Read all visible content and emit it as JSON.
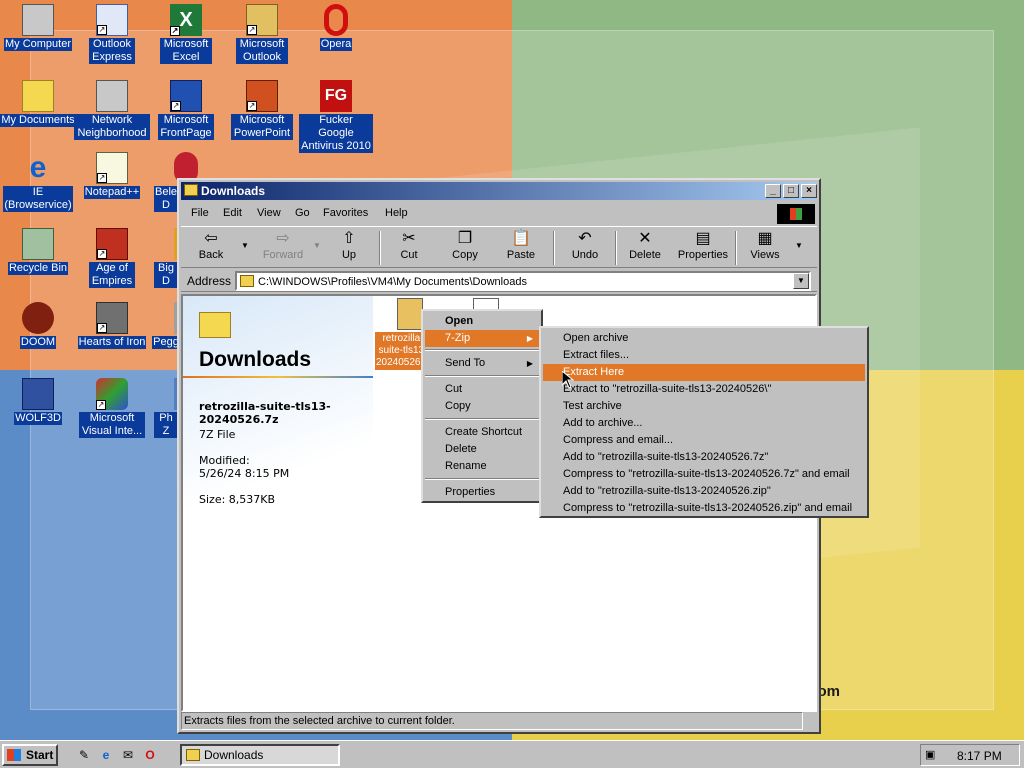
{
  "desktop": {
    "brand_fragment": "t.com",
    "icons": [
      {
        "label": "My Computer"
      },
      {
        "label": "Outlook Express"
      },
      {
        "label": "Microsoft Excel"
      },
      {
        "label": "Microsoft Outlook"
      },
      {
        "label": "Opera"
      },
      {
        "label": "My Documents"
      },
      {
        "label": "Network Neighborhood"
      },
      {
        "label": "Microsoft FrontPage"
      },
      {
        "label": "Microsoft PowerPoint"
      },
      {
        "label": "Fucker Google Antivirus 2010"
      },
      {
        "label": "IE (Browservice)"
      },
      {
        "label": "Notepad++"
      },
      {
        "label": "Bele D"
      },
      {
        "label": "Recycle Bin"
      },
      {
        "label": "Age of Empires"
      },
      {
        "label": "Big D"
      },
      {
        "label": "DOOM"
      },
      {
        "label": "Hearts of Iron"
      },
      {
        "label": "Pegg"
      },
      {
        "label": "WOLF3D"
      },
      {
        "label": "Microsoft Visual Inte..."
      },
      {
        "label": "Ph Z"
      }
    ]
  },
  "window": {
    "title": "Downloads",
    "menu": {
      "file": "File",
      "edit": "Edit",
      "view": "View",
      "go": "Go",
      "favorites": "Favorites",
      "help": "Help"
    },
    "toolbar": {
      "back": "Back",
      "forward": "Forward",
      "up": "Up",
      "cut": "Cut",
      "copy": "Copy",
      "paste": "Paste",
      "undo": "Undo",
      "delete": "Delete",
      "properties": "Properties",
      "views": "Views"
    },
    "address": {
      "label": "Address",
      "path": "C:\\WINDOWS\\Profiles\\VM4\\My Documents\\Downloads"
    },
    "panel": {
      "title": "Downloads",
      "file_name": "retrozilla-suite-tls13-20240526.7z",
      "file_type": "7Z File",
      "modified_label": "Modified:",
      "modified_value": "5/26/24 8:15 PM",
      "size": "Size: 8,537KB"
    },
    "selected_file_label": "retrozilla-suite-tls13-20240526.7z",
    "status": "Extracts files from the selected archive to current folder."
  },
  "context_menu": {
    "open": "Open",
    "seven_zip": "7-Zip",
    "send_to": "Send To",
    "cut": "Cut",
    "copy": "Copy",
    "create_shortcut": "Create Shortcut",
    "delete": "Delete",
    "rename": "Rename",
    "properties": "Properties"
  },
  "submenu": {
    "items": [
      "Open archive",
      "Extract files...",
      "Extract Here",
      "Extract to \"retrozilla-suite-tls13-20240526\\\"",
      "Test archive",
      "Add to archive...",
      "Compress and email...",
      "Add to \"retrozilla-suite-tls13-20240526.7z\"",
      "Compress to \"retrozilla-suite-tls13-20240526.7z\" and email",
      "Add to \"retrozilla-suite-tls13-20240526.zip\"",
      "Compress to \"retrozilla-suite-tls13-20240526.zip\" and email"
    ],
    "highlighted_index": 2,
    "highlight_color": "#e07828"
  },
  "taskbar": {
    "start": "Start",
    "task": "Downloads",
    "clock": "8:17 PM"
  }
}
